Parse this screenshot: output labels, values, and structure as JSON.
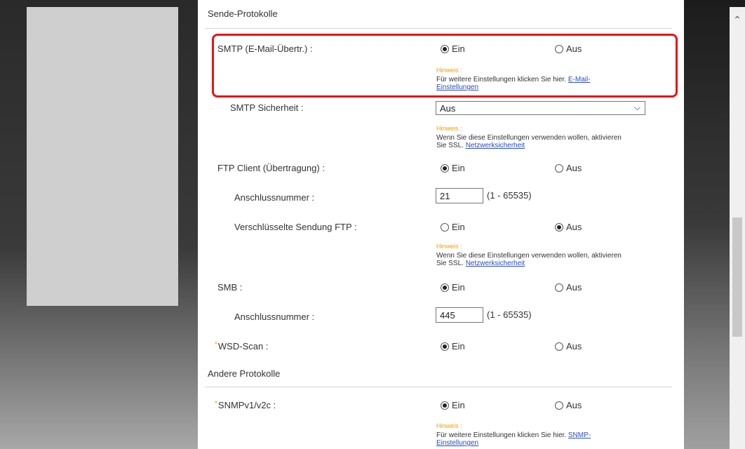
{
  "send_protocols": {
    "title": "Sende-Protokolle",
    "smtp": {
      "label": "SMTP (E-Mail-Übertr.) :",
      "on_label": "Ein",
      "off_label": "Aus",
      "hint_title": "Hinweis :",
      "hint_text": "Für weitere Einstellungen klicken Sie hier. ",
      "hint_link_1": "E-Mail-",
      "hint_link_2": "Einstellungen"
    },
    "smtp_security": {
      "label": "SMTP Sicherheit :",
      "value": "Aus",
      "hint_title": "Hinweis :",
      "hint_line1": "Wenn Sie diese Einstellungen verwenden wollen, aktivieren",
      "hint_line2": "Sie SSL. ",
      "hint_link": "Netzwerksicherheit"
    },
    "ftp_client": {
      "label": "FTP Client (Übertragung) :",
      "on_label": "Ein",
      "off_label": "Aus"
    },
    "ftp_port": {
      "label": "Anschlussnummer :",
      "value": "21",
      "range": "(1 - 65535)"
    },
    "ftp_encrypted": {
      "label": "Verschlüsselte Sendung FTP :",
      "on_label": "Ein",
      "off_label": "Aus",
      "hint_title": "Hinweis :",
      "hint_line1": "Wenn Sie diese Einstellungen verwenden wollen, aktivieren",
      "hint_line2": "Sie SSL. ",
      "hint_link": "Netzwerksicherheit"
    },
    "smb": {
      "label": "SMB :",
      "on_label": "Ein",
      "off_label": "Aus"
    },
    "smb_port": {
      "label": "Anschlussnummer :",
      "value": "445",
      "range": "(1 - 65535)"
    },
    "wsd_scan": {
      "star": "*",
      "label": "WSD-Scan :",
      "on_label": "Ein",
      "off_label": "Aus"
    }
  },
  "other_protocols": {
    "title": "Andere Protokolle",
    "snmp": {
      "star": "*",
      "label": "SNMPv1/v2c :",
      "on_label": "Ein",
      "off_label": "Aus",
      "hint_title": "Hinweis :",
      "hint_text": "Für weitere Einstellungen klicken Sie hier. ",
      "hint_link_1": "SNMP-",
      "hint_link_2": "Einstellungen"
    }
  },
  "icons": {
    "scroll_up": "chevron-up-icon",
    "dropdown": "chevron-down-icon"
  },
  "colors": {
    "highlight": "#e01818",
    "hint": "#f0a000",
    "link": "#2a4dbd"
  }
}
